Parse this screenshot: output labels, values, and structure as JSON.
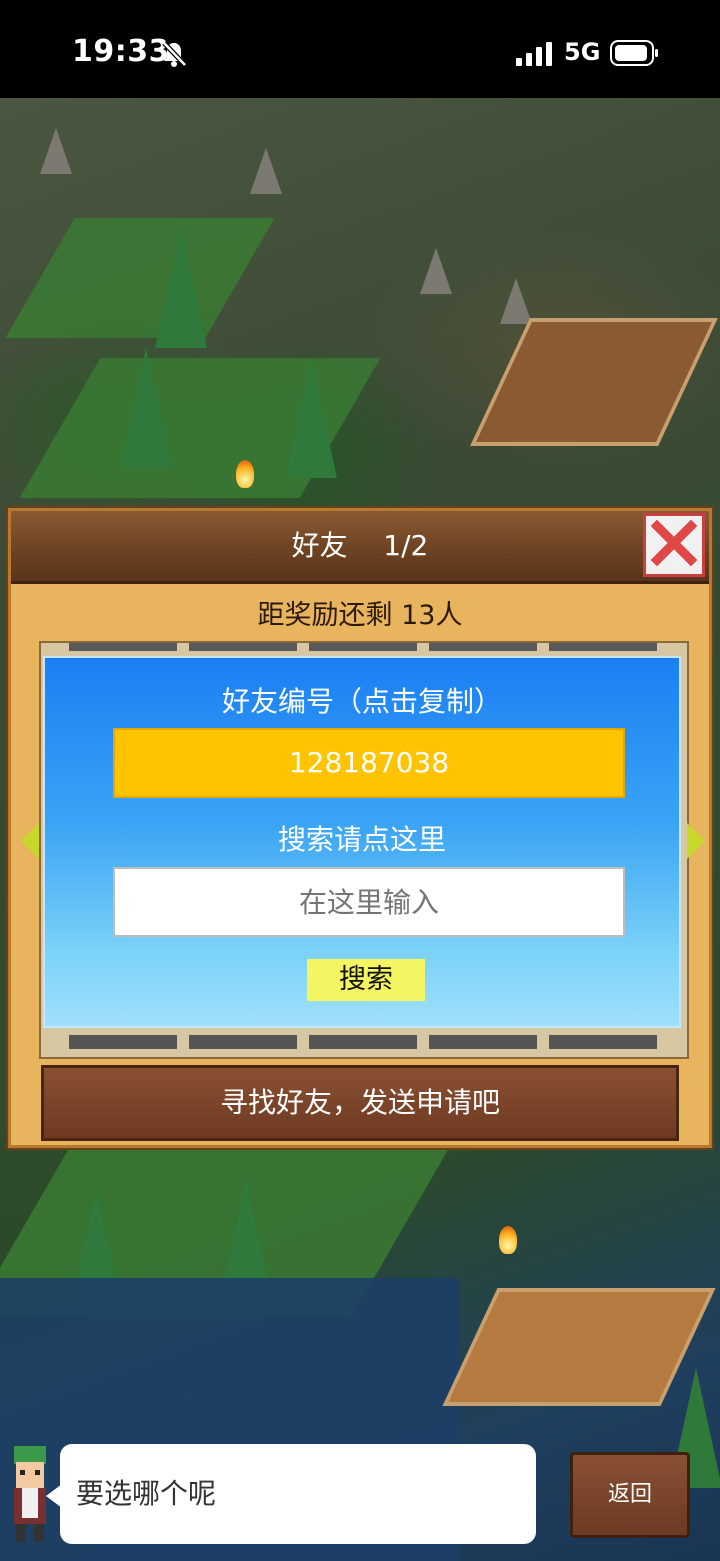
{
  "status_bar": {
    "time": "19:33",
    "network": "5G",
    "icons": [
      "bell-slash-icon",
      "signal-bars-icon",
      "battery-icon"
    ]
  },
  "dialog": {
    "title": "好友",
    "page": "1/2",
    "reward_text": "距奖励还剩 13人",
    "friend_id_label": "好友编号（点击复制）",
    "friend_id": "128187038",
    "search_hint": "搜索请点这里",
    "search_placeholder": "在这里输入",
    "search_button": "搜索",
    "send_request_button": "寻找好友，发送申请吧"
  },
  "bottom_bar": {
    "speech_text": "要选哪个呢",
    "back_button": "返回"
  },
  "colors": {
    "dialog_bg": "#e9b45e",
    "title_bar": "#6e4323",
    "card_blue": "#1b7ff4",
    "friend_id_bg": "#ffc300",
    "search_button_bg": "#f4f562",
    "close_red": "#c94040"
  }
}
